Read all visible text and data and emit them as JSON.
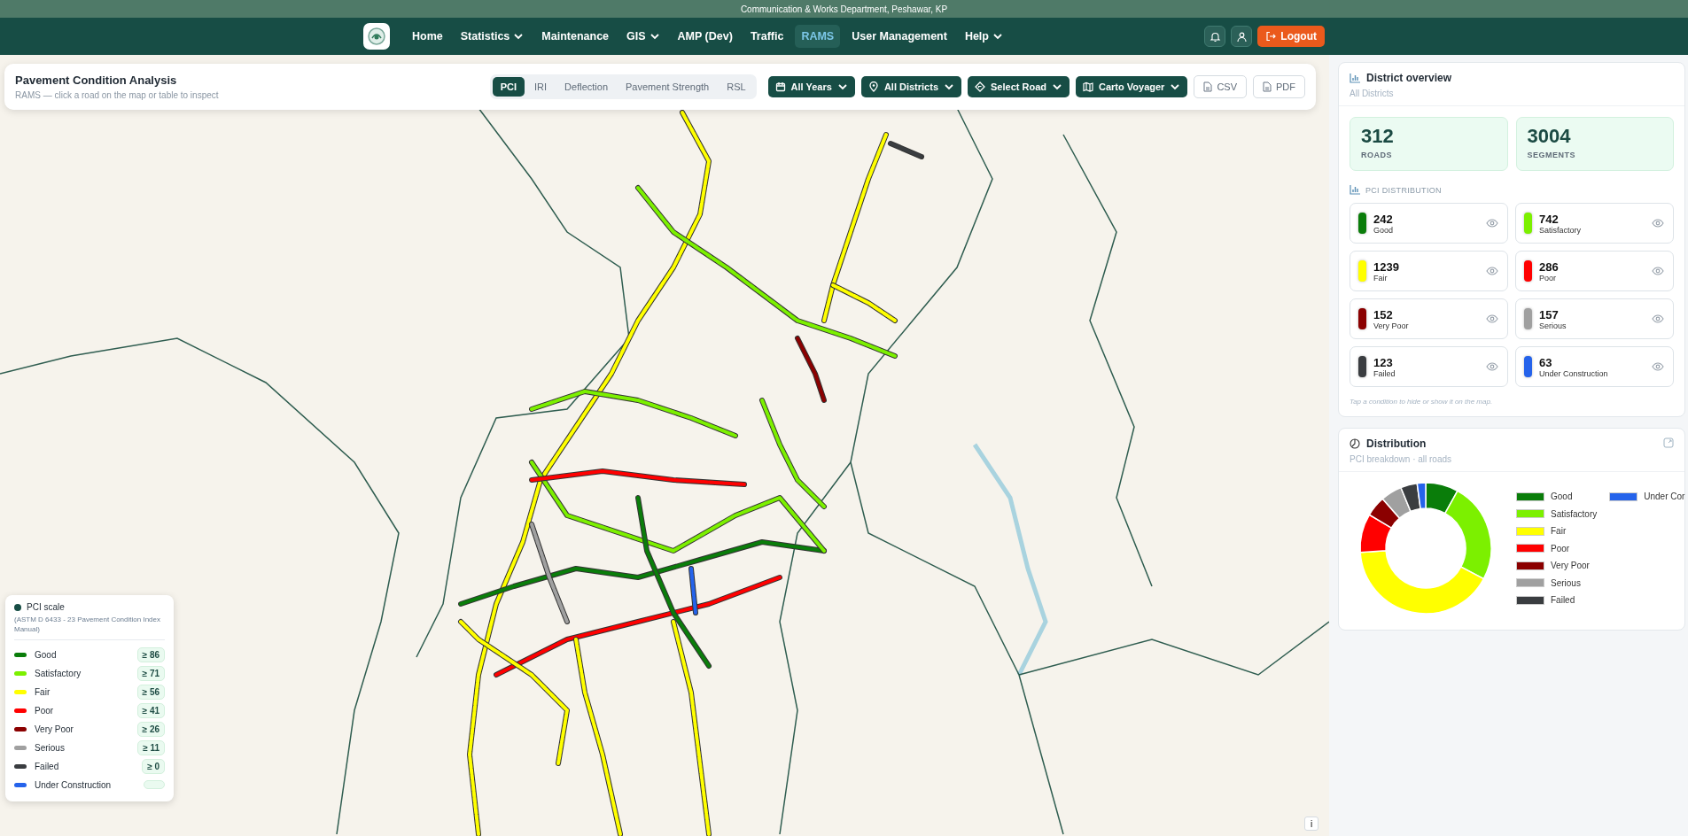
{
  "banner": "Communication & Works Department, Peshawar, KP",
  "nav": {
    "items": [
      {
        "label": "Home",
        "dropdown": false,
        "selected": false
      },
      {
        "label": "Statistics",
        "dropdown": true,
        "selected": false
      },
      {
        "label": "Maintenance",
        "dropdown": false,
        "selected": false
      },
      {
        "label": "GIS",
        "dropdown": true,
        "selected": false
      },
      {
        "label": "AMP (Dev)",
        "dropdown": false,
        "selected": false
      },
      {
        "label": "Traffic",
        "dropdown": false,
        "selected": false
      },
      {
        "label": "RAMS",
        "dropdown": false,
        "selected": true
      },
      {
        "label": "User Management",
        "dropdown": false,
        "selected": false
      },
      {
        "label": "Help",
        "dropdown": true,
        "selected": false
      }
    ],
    "logout": "Logout"
  },
  "toolbar": {
    "title": "Pavement Condition Analysis",
    "subtitle": "RAMS — click a road on the map or table to inspect",
    "tabs": [
      {
        "label": "PCI",
        "selected": true
      },
      {
        "label": "IRI",
        "selected": false
      },
      {
        "label": "Deflection",
        "selected": false
      },
      {
        "label": "Pavement Strength",
        "selected": false
      },
      {
        "label": "RSL",
        "selected": false
      }
    ],
    "filters": [
      {
        "kind": "calendar",
        "label": "All Years"
      },
      {
        "kind": "pin",
        "label": "All Districts"
      },
      {
        "kind": "diamond",
        "label": "Select Road"
      },
      {
        "kind": "map",
        "label": "Carto Voyager"
      }
    ],
    "exports": [
      "CSV",
      "PDF"
    ]
  },
  "legend": {
    "title": "PCI scale",
    "note": "(ASTM D 6433 - 23 Pavement Condition Index Manual)",
    "items": [
      {
        "label": "Good",
        "color": "#0a7d0a",
        "threshold": "≥ 86"
      },
      {
        "label": "Satisfactory",
        "color": "#7cf000",
        "threshold": "≥ 71"
      },
      {
        "label": "Fair",
        "color": "#ffff00",
        "threshold": "≥ 56"
      },
      {
        "label": "Poor",
        "color": "#ff0000",
        "threshold": "≥ 41"
      },
      {
        "label": "Very Poor",
        "color": "#8b0000",
        "threshold": "≥ 26"
      },
      {
        "label": "Serious",
        "color": "#a0a0a0",
        "threshold": "≥ 11"
      },
      {
        "label": "Failed",
        "color": "#3a3d40",
        "threshold": "≥ 0"
      },
      {
        "label": "Under Construction",
        "color": "#2563eb"
      }
    ]
  },
  "overview": {
    "title": "District overview",
    "subtitle": "All Districts",
    "stats": [
      {
        "value": "312",
        "label": "ROADS"
      },
      {
        "value": "3004",
        "label": "SEGMENTS"
      }
    ],
    "section": "PCI DISTRIBUTION",
    "conditions": [
      {
        "count": "242",
        "label": "Good",
        "color": "#0a7d0a"
      },
      {
        "count": "742",
        "label": "Satisfactory",
        "color": "#7cf000"
      },
      {
        "count": "1239",
        "label": "Fair",
        "color": "#ffff00"
      },
      {
        "count": "286",
        "label": "Poor",
        "color": "#ff0000"
      },
      {
        "count": "152",
        "label": "Very Poor",
        "color": "#8b0000"
      },
      {
        "count": "157",
        "label": "Serious",
        "color": "#a0a0a0"
      },
      {
        "count": "123",
        "label": "Failed",
        "color": "#3a3d40"
      },
      {
        "count": "63",
        "label": "Under Construction",
        "color": "#2563eb"
      }
    ],
    "hint": "Tap a condition to hide or show it on the map."
  },
  "distribution": {
    "title": "Distribution",
    "subtitle": "PCI breakdown · all roads",
    "chart_data": {
      "type": "donut",
      "categories": [
        "Good",
        "Satisfactory",
        "Fair",
        "Poor",
        "Very Poor",
        "Serious",
        "Failed",
        "Under Cor"
      ],
      "values": [
        8.06,
        24.7,
        41.24,
        9.52,
        5.06,
        5.23,
        4.09,
        2.1
      ],
      "legend": "right",
      "colors": [
        "#0a7d0a",
        "#7cf000",
        "#ffff00",
        "#ff0000",
        "#8b0000",
        "#a0a0a0",
        "#3a3d40",
        "#2563eb"
      ]
    }
  },
  "map_info": "i"
}
